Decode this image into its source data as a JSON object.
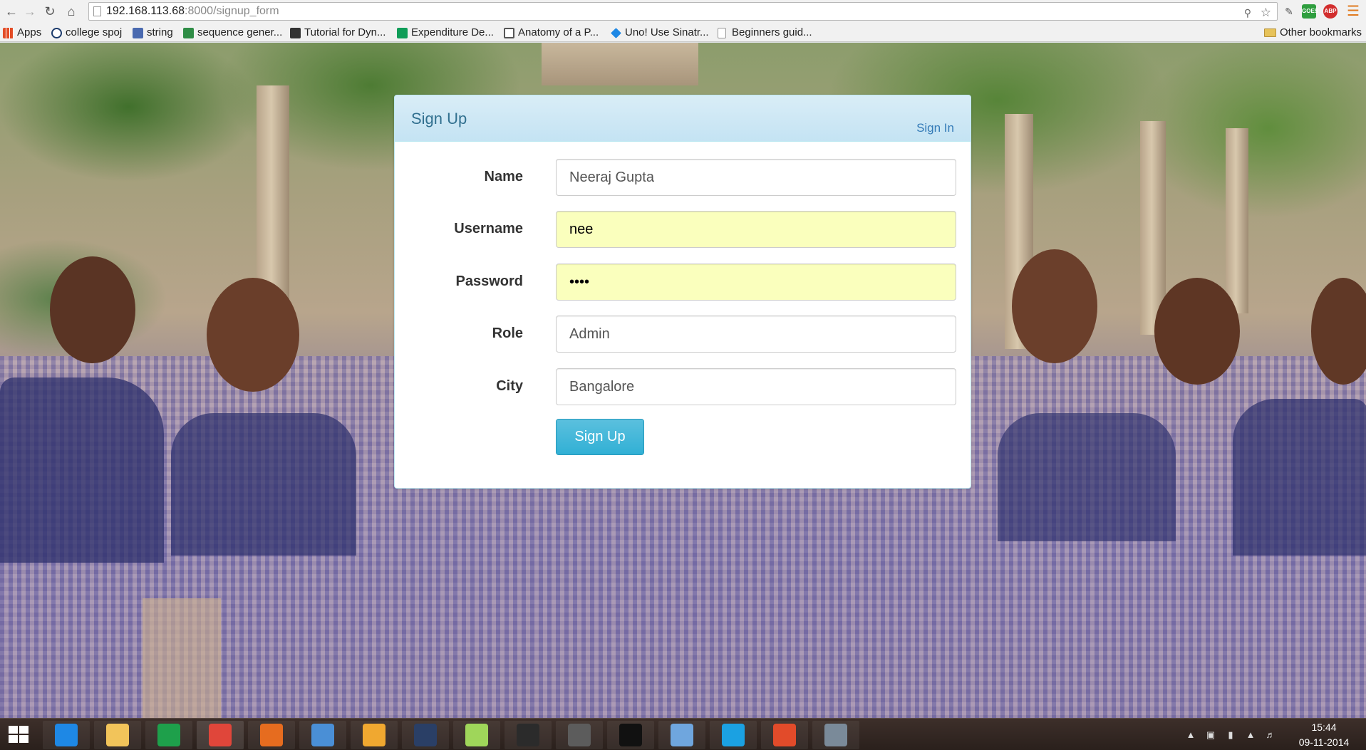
{
  "browser": {
    "url_host": "192.168.113.68",
    "url_path": ":8000/signup_form",
    "bookmarks": [
      {
        "label": "Apps",
        "icon": "apps-grid-icon",
        "color": "#e34c26"
      },
      {
        "label": "college spoj",
        "icon": "spoj-icon",
        "color": "#1b3a6b"
      },
      {
        "label": "string",
        "icon": "string-icon",
        "color": "#4a6ab0"
      },
      {
        "label": "sequence gener...",
        "icon": "geeks-icon",
        "color": "#2f8d46"
      },
      {
        "label": "Tutorial for Dyn...",
        "icon": "cc-icon",
        "color": "#333333"
      },
      {
        "label": "Expenditure De...",
        "icon": "sheets-icon",
        "color": "#0f9d58"
      },
      {
        "label": "Anatomy of a P...",
        "icon": "page-o-icon",
        "color": "#555555"
      },
      {
        "label": "Uno! Use Sinatr...",
        "icon": "diamond-icon",
        "color": "#1e88e5"
      },
      {
        "label": "Beginners guid...",
        "icon": "blank-page-icon",
        "color": "#ffffff"
      }
    ],
    "other_bookmarks": "Other bookmarks",
    "extensions": [
      {
        "label": "GOES",
        "color": "#2e9e3e"
      },
      {
        "label": "ABP",
        "color": "#d22d2d"
      }
    ]
  },
  "signup_panel": {
    "title": "Sign Up",
    "signin_link": "Sign In",
    "fields": [
      {
        "label": "Name",
        "value": "Neeraj Gupta"
      },
      {
        "label": "Username",
        "value": "nee"
      },
      {
        "label": "Password",
        "value": "••••"
      },
      {
        "label": "Role",
        "value": "Admin"
      },
      {
        "label": "City",
        "value": "Bangalore"
      }
    ],
    "submit_label": "Sign Up",
    "colors": {
      "heading_bg": "#d9edf7",
      "heading_text": "#31708f",
      "link": "#337ab7",
      "autofill_bg": "#faffbd",
      "button": "#5bc0de"
    }
  },
  "taskbar": {
    "apps": [
      {
        "name": "internet-explorer-icon",
        "color": "#1e88e5"
      },
      {
        "name": "file-explorer-icon",
        "color": "#f2c45a"
      },
      {
        "name": "store-icon",
        "color": "#1ea04b"
      },
      {
        "name": "chrome-icon",
        "color": "#e0463a"
      },
      {
        "name": "firefox-icon",
        "color": "#e66c1f"
      },
      {
        "name": "remote-app-icon",
        "color": "#4a8fd6"
      },
      {
        "name": "outlook-icon",
        "color": "#f0a830"
      },
      {
        "name": "r-studio-icon",
        "color": "#2a3f66"
      },
      {
        "name": "sticky-notes-icon",
        "color": "#9fd65a"
      },
      {
        "name": "console-icon",
        "color": "#2b2b2b"
      },
      {
        "name": "sublime-text-icon",
        "color": "#5c5c5c"
      },
      {
        "name": "terminal-icon",
        "color": "#111111"
      },
      {
        "name": "search-tool-icon",
        "color": "#6fa6de"
      },
      {
        "name": "skype-icon",
        "color": "#1ba1e2"
      },
      {
        "name": "git-icon",
        "color": "#e24b2a"
      },
      {
        "name": "network-tool-icon",
        "color": "#7a8a99"
      }
    ],
    "time": "15:44",
    "date": "09-11-2014"
  }
}
